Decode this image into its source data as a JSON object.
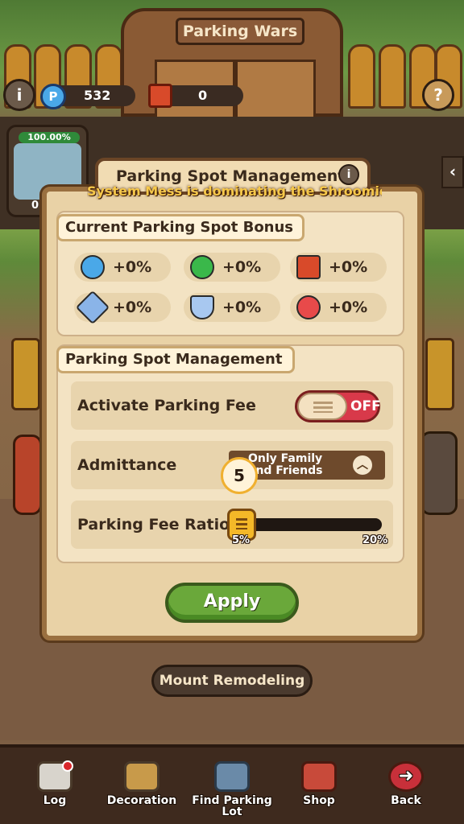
{
  "header": {
    "title": "Parking Wars",
    "resources": [
      {
        "icon": "parking-coin-icon",
        "value": "532"
      },
      {
        "icon": "ticket-book-icon",
        "value": "0"
      }
    ]
  },
  "car_card": {
    "percent": "100.00%",
    "id_partial": "01"
  },
  "dialog": {
    "title": "Parking Spot Management",
    "system_message": "System Mess is dominating the Shroomie C",
    "bonus_section": {
      "title": "Current Parking Spot Bonus",
      "items": [
        {
          "icon": "parking-coin-icon",
          "value": "+0%",
          "color": "#4aa8e8"
        },
        {
          "icon": "clover-icon",
          "value": "+0%",
          "color": "#3ab84a"
        },
        {
          "icon": "ticket-book-icon",
          "value": "+0%",
          "color": "#d84a2a"
        },
        {
          "icon": "sword-icon",
          "value": "+0%",
          "color": "#8ab4e8"
        },
        {
          "icon": "shield-icon",
          "value": "+0%",
          "color": "#a8c8f0"
        },
        {
          "icon": "heart-icon",
          "value": "+0%",
          "color": "#e84a4a"
        }
      ]
    },
    "management_section": {
      "title": "Parking Spot Management",
      "parking_fee": {
        "label": "Activate Parking Fee",
        "state": "OFF"
      },
      "admittance": {
        "label": "Admittance",
        "value": "Only Family and Friends"
      },
      "fee_ratio": {
        "label": "Parking Fee Ratio",
        "current": "5",
        "min": "5%",
        "max": "20%",
        "level": 0
      }
    },
    "apply_label": "Apply"
  },
  "mount_remodeling_label": "Mount Remodeling",
  "bottom_nav": [
    {
      "label": "Log",
      "icon": "clipboard-icon",
      "badge": true
    },
    {
      "label": "Decoration",
      "icon": "paintbrush-icon",
      "badge": false
    },
    {
      "label": "Find Parking Lot",
      "icon": "map-search-icon",
      "badge": false
    },
    {
      "label": "Shop",
      "icon": "shop-icon",
      "badge": false
    },
    {
      "label": "Back",
      "icon": "back-icon",
      "badge": false
    }
  ],
  "colors": {
    "accent_green": "#6aa83a",
    "toggle_off": "#d8394a",
    "panel": "#e9d2a6"
  }
}
